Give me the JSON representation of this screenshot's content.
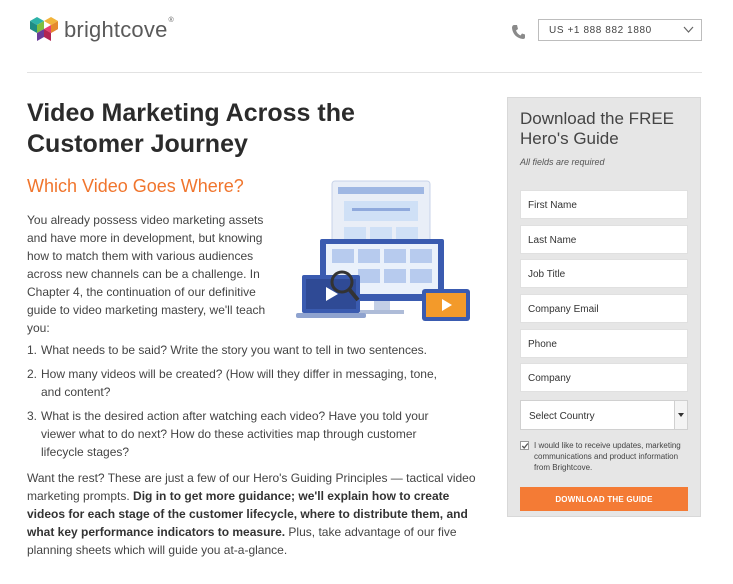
{
  "header": {
    "logo_text": "brightcove",
    "logo_mark": "®",
    "phone_selector": "US +1 888 882 1880"
  },
  "main": {
    "title": "Video Marketing Across the Customer Journey",
    "subtitle": "Which Video Goes Where?",
    "intro": "You already possess video marketing assets and have more in development, but knowing how to match them with various audiences across new channels can be a challenge. In Chapter 4, the continuation of our definitive guide to video marketing mastery, we'll teach you:",
    "questions": [
      {
        "num": "1.",
        "text": "What needs to be said? Write the story you want to tell in two sentences."
      },
      {
        "num": "2.",
        "text": "How many videos will be created? (How will they differ in messaging, tone, and content?"
      },
      {
        "num": "3.",
        "text": "What is the desired action after watching each video? Have you told your viewer what to do next? How do these activities map through customer lifecycle stages?"
      }
    ],
    "closing_start": "Want the rest? These are just a few of our Hero's Guiding Principles — tactical video marketing prompts. ",
    "closing_bold": "Dig in to get more guidance; we'll explain how to create videos for each stage of the customer lifecycle, where to distribute them, and what key performance indicators to measure.",
    "closing_end": " Plus, take advantage of our five planning sheets which will guide you at-a-glance."
  },
  "form": {
    "title": "Download the FREE Hero's Guide",
    "note": "All fields are required",
    "fields": {
      "first_name": "First Name",
      "last_name": "Last Name",
      "job_title": "Job Title",
      "company_email": "Company Email",
      "phone": "Phone",
      "company": "Company"
    },
    "country": "Select Country",
    "consent": "I would like to receive updates, marketing communications and product information from Brightcove.",
    "submit": "DOWNLOAD THE GUIDE"
  },
  "colors": {
    "accent": "#f47b35",
    "subtitle": "#f0752d",
    "panel": "#e6e6e6",
    "illustration_blue": "#3a5bb0"
  }
}
